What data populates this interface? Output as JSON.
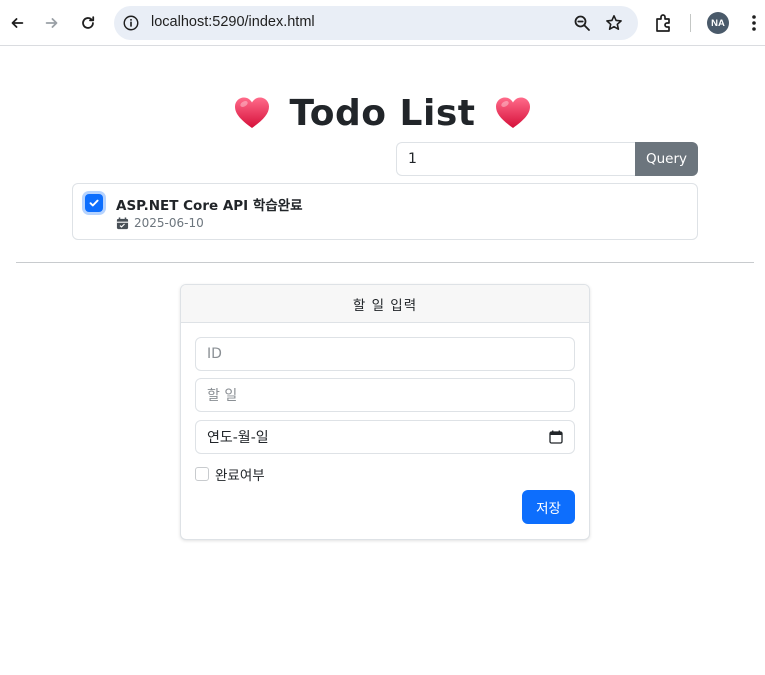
{
  "browser": {
    "url": "localhost:5290/index.html",
    "profile_initials": "NA"
  },
  "page": {
    "title": "Todo List",
    "heart_emoji": "❤️"
  },
  "query": {
    "value": "1",
    "button_label": "Query"
  },
  "todos": [
    {
      "title": "ASP.NET Core API 학습완료",
      "date": "2025-06-10",
      "done": true
    }
  ],
  "form": {
    "header": "할 일 입력",
    "id_placeholder": "ID",
    "task_placeholder": "할 일",
    "date_placeholder": "연도-월-일",
    "done_label": "완료여부",
    "save_label": "저장"
  },
  "colors": {
    "primary": "#0d6efd",
    "secondary": "#6c757d",
    "heart": "#e8234a"
  }
}
